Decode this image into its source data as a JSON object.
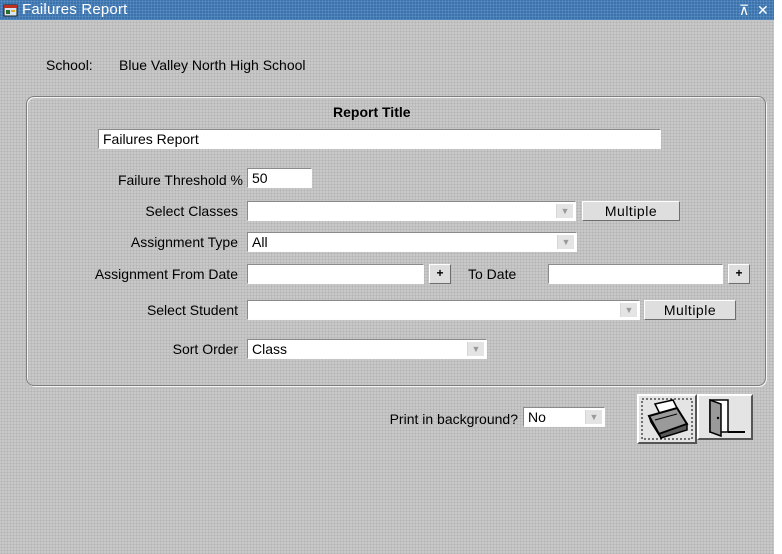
{
  "window": {
    "title": "Failures Report",
    "controls": {
      "restore_glyph": "⊼",
      "close_glyph": "✕"
    }
  },
  "school": {
    "label": "School:",
    "name": "Blue Valley North High School"
  },
  "report_title": {
    "heading": "Report Title",
    "value": "Failures Report"
  },
  "failure_threshold": {
    "label": "Failure Threshold %",
    "value": "50"
  },
  "select_classes": {
    "label": "Select Classes",
    "value": "",
    "multiple_label": "Multiple"
  },
  "assignment_type": {
    "label": "Assignment Type",
    "value": "All"
  },
  "assignment_from_date": {
    "label": "Assignment From Date",
    "value": "",
    "picker_label": "+"
  },
  "to_date": {
    "label": "To Date",
    "value": "",
    "picker_label": "+"
  },
  "select_student": {
    "label": "Select Student",
    "value": "",
    "multiple_label": "Multiple"
  },
  "sort_order": {
    "label": "Sort Order",
    "value": "Class"
  },
  "print_in_background": {
    "label": "Print in background?",
    "value": "No"
  },
  "icons": {
    "print": "printer-icon",
    "exit": "exit-door-icon",
    "app": "app-window-icon"
  },
  "colors": {
    "titlebar": "#3d73ad",
    "window_bg": "#c8c8c8",
    "field_bg": "#ffffff"
  }
}
